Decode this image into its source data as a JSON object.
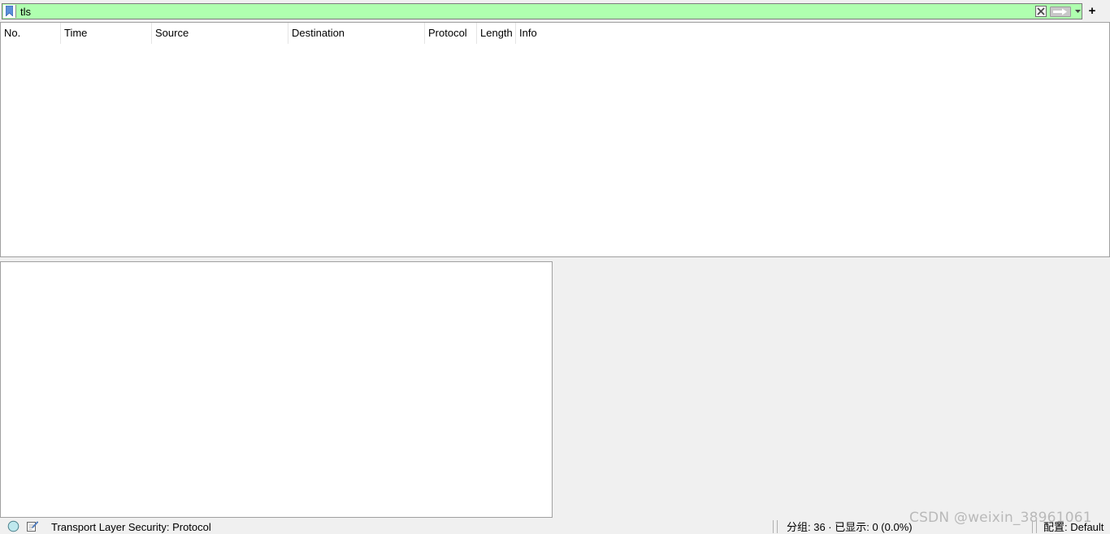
{
  "filter": {
    "value": "tls",
    "add_label": "+",
    "background_color": "#afffaf"
  },
  "packet_list": {
    "columns": [
      "No.",
      "Time",
      "Source",
      "Destination",
      "Protocol",
      "Length",
      "Info"
    ],
    "rows": []
  },
  "status": {
    "field_text": "Transport Layer Security: Protocol",
    "packets_text": "分组: 36 · 已显示: 0 (0.0%)",
    "profile_text": "配置: Default"
  },
  "watermark": "CSDN @weixin_38961061",
  "icons": {
    "bookmark": "bookmark-icon",
    "clear": "clear-filter-icon",
    "apply": "apply-arrow-icon",
    "dropdown": "chevron-down-icon",
    "expert": "expert-info-icon",
    "comment": "capture-comment-icon"
  }
}
